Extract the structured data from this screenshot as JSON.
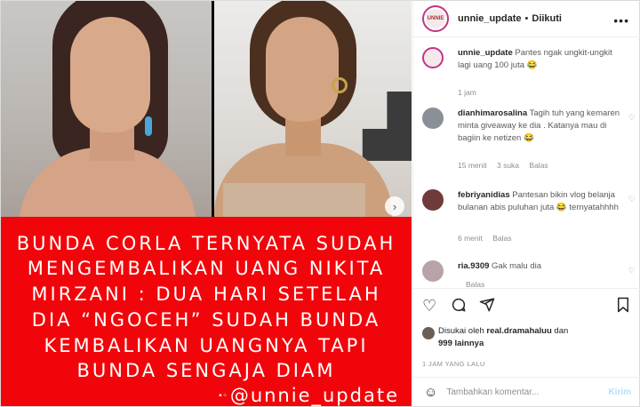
{
  "post": {
    "banner_lines": [
      "BUNDA CORLA TERNYATA SUDAH",
      "MENGEMBALIKAN UANG NIKITA",
      "MIRZANI : DUA HARI SETELAH",
      "DIA “NGOCEH” SUDAH BUNDA",
      "KEMBALIKAN UANGNYA TAPI",
      "BUNDA SENGAJA DIAM"
    ],
    "banner_handle": "@unnie_update",
    "next_icon": "chevron-right-icon"
  },
  "header": {
    "username": "unnie_update",
    "separator": "•",
    "follow_label": "Diikuti",
    "more_icon": "more-horizontal-icon"
  },
  "comments": [
    {
      "username": "unnie_update",
      "text": "Pantes ngak ungkit-ungkit lagi uang 100 juta 😂",
      "time": "1 jam",
      "likes": "",
      "reply": ""
    },
    {
      "username": "dianhimarosalina",
      "text": "Tagih tuh yang kemaren minta giveaway ke dia . Katanya mau di bagiin ke netizen 😂",
      "time": "15 menit",
      "likes": "3 suka",
      "reply": "Balas"
    },
    {
      "username": "febriyanidias",
      "text": "Pantesan bikin vlog belanja bulanan abis puluhan juta 😂 ternyatahhhh",
      "time": "6 menit",
      "likes": "",
      "reply": "Balas"
    },
    {
      "username": "ria.9309",
      "text": "Gak malu dia",
      "time": "",
      "likes": "",
      "reply": "Balas"
    }
  ],
  "actions": {
    "like_icon": "heart-icon",
    "comment_icon": "comment-icon",
    "share_icon": "send-icon",
    "save_icon": "bookmark-icon"
  },
  "likes": {
    "prefix": "Disukai oleh",
    "user": "real.dramahaluu",
    "conj": "dan",
    "others": "999 lainnya"
  },
  "timestamp": "1 JAM YANG LALU",
  "add_comment": {
    "placeholder": "Tambahkan komentar...",
    "post_label": "Kirim",
    "emoji_icon": "smiley-icon"
  }
}
